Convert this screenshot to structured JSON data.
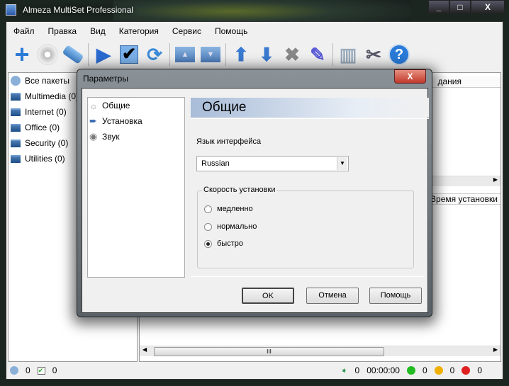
{
  "window": {
    "title": "Almeza MultiSet Professional",
    "controls": [
      "_",
      "□",
      "X"
    ]
  },
  "menu": [
    "Файл",
    "Правка",
    "Вид",
    "Категория",
    "Сервис",
    "Помощь"
  ],
  "toolbar": [
    "add",
    "cd",
    "usb",
    "play",
    "check",
    "refresh",
    "folder-up",
    "folder-down",
    "arrow-up",
    "arrow-down",
    "delete",
    "edit",
    "install",
    "tools",
    "help"
  ],
  "categories": [
    {
      "label": "Все пакеты",
      "icon": "all-packages-icon"
    },
    {
      "label": "Multimedia (0)",
      "icon": "folder-icon"
    },
    {
      "label": "Internet (0)",
      "icon": "folder-icon"
    },
    {
      "label": "Office (0)",
      "icon": "folder-icon"
    },
    {
      "label": "Security (0)",
      "icon": "folder-icon"
    },
    {
      "label": "Utilities (0)",
      "icon": "folder-icon"
    }
  ],
  "top_list": {
    "header": "дания"
  },
  "bottom_list": {
    "header": "Время установки",
    "scroll_grip": "III"
  },
  "status": {
    "packages": "0",
    "checked": "0",
    "running": "0",
    "time": "00:00:00",
    "green": "0",
    "yellow": "0",
    "red": "0",
    "colors": {
      "green": "#22bb22",
      "yellow": "#f0b000",
      "red": "#e02020"
    }
  },
  "dialog": {
    "title": "Параметры",
    "close": "X",
    "nav": [
      {
        "label": "Общие",
        "icon": "☼"
      },
      {
        "label": "Установка",
        "icon": "➨"
      },
      {
        "label": "Звук",
        "icon": "◉"
      }
    ],
    "section_title": "Общие",
    "language_label": "Язык интерфейса",
    "language_value": "Russian",
    "speed_group": "Скорость установки",
    "speed_options": [
      "медленно",
      "нормально",
      "быстро"
    ],
    "speed_selected": "быстро",
    "buttons": {
      "ok": "OK",
      "cancel": "Отмена",
      "help": "Помощь"
    }
  }
}
